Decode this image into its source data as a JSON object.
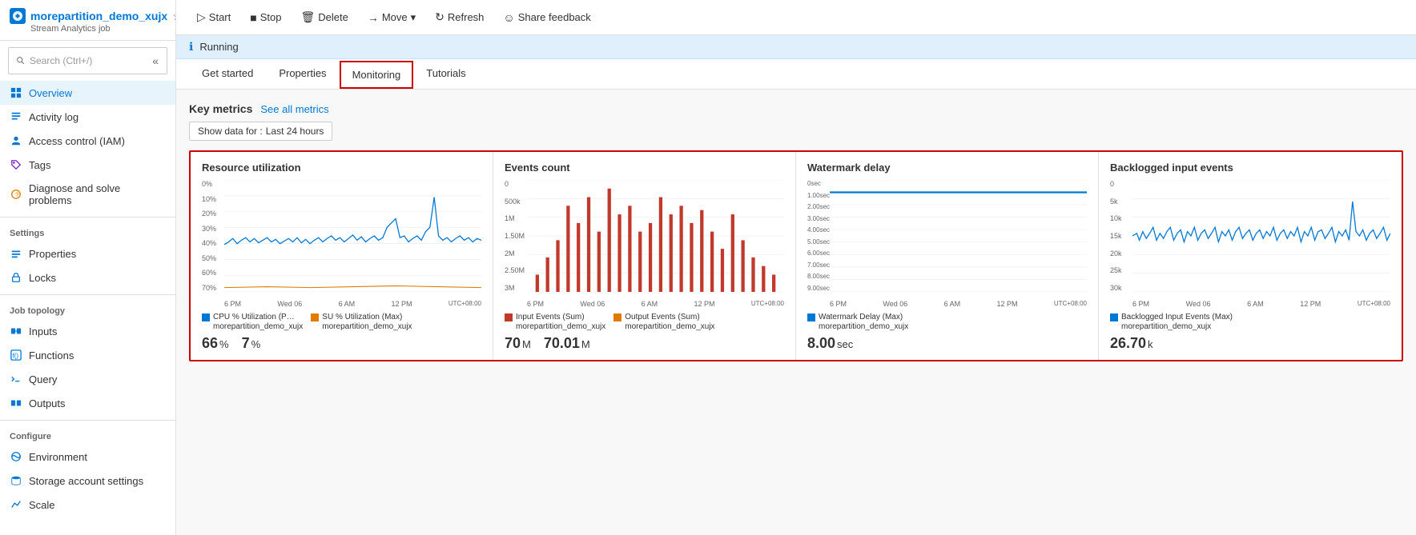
{
  "app": {
    "name": "morepartition_demo_xujx",
    "subtitle": "Stream Analytics job",
    "star_icon": "★",
    "dots_icon": "···"
  },
  "sidebar": {
    "search_placeholder": "Search (Ctrl+/)",
    "items_top": [
      {
        "id": "overview",
        "label": "Overview",
        "icon": "overview",
        "active": true
      },
      {
        "id": "activity-log",
        "label": "Activity log",
        "icon": "list"
      },
      {
        "id": "access-control",
        "label": "Access control (IAM)",
        "icon": "person"
      },
      {
        "id": "tags",
        "label": "Tags",
        "icon": "tag"
      },
      {
        "id": "diagnose",
        "label": "Diagnose and solve problems",
        "icon": "wrench"
      }
    ],
    "settings_label": "Settings",
    "settings_items": [
      {
        "id": "properties",
        "label": "Properties",
        "icon": "properties"
      },
      {
        "id": "locks",
        "label": "Locks",
        "icon": "lock"
      }
    ],
    "job_topology_label": "Job topology",
    "job_topology_items": [
      {
        "id": "inputs",
        "label": "Inputs",
        "icon": "inputs"
      },
      {
        "id": "functions",
        "label": "Functions",
        "icon": "functions"
      },
      {
        "id": "query",
        "label": "Query",
        "icon": "query"
      },
      {
        "id": "outputs",
        "label": "Outputs",
        "icon": "outputs"
      }
    ],
    "configure_label": "Configure",
    "configure_items": [
      {
        "id": "environment",
        "label": "Environment",
        "icon": "environment"
      },
      {
        "id": "storage-account",
        "label": "Storage account settings",
        "icon": "storage"
      },
      {
        "id": "scale",
        "label": "Scale",
        "icon": "scale"
      }
    ]
  },
  "toolbar": {
    "start_label": "Start",
    "stop_label": "Stop",
    "delete_label": "Delete",
    "move_label": "Move",
    "refresh_label": "Refresh",
    "share_feedback_label": "Share feedback"
  },
  "status": {
    "text": "Running"
  },
  "tabs": [
    {
      "id": "get-started",
      "label": "Get started"
    },
    {
      "id": "properties",
      "label": "Properties"
    },
    {
      "id": "monitoring",
      "label": "Monitoring",
      "active": true
    },
    {
      "id": "tutorials",
      "label": "Tutorials"
    }
  ],
  "key_metrics": {
    "title": "Key metrics",
    "see_all_label": "See all metrics",
    "filter_label": "Show data for :",
    "filter_value": "Last 24 hours"
  },
  "charts": [
    {
      "id": "resource-utilization",
      "title": "Resource utilization",
      "y_labels": [
        "70%",
        "60%",
        "50%",
        "40%",
        "30%",
        "20%",
        "10%",
        "0%"
      ],
      "x_labels": [
        "6 PM",
        "Wed 06",
        "6 AM",
        "12 PM",
        "UTC+08:00"
      ],
      "color": "#0078d4",
      "type": "line",
      "legend": [
        {
          "label": "CPU % Utilization (P…\nmorepartition_demo_xujx",
          "color": "#0078d4"
        },
        {
          "label": "SU % Utilization (Max)\nmorepartition_demo_xujx",
          "color": "#e07b00"
        }
      ],
      "values": [
        {
          "num": "66",
          "unit": "%"
        },
        {
          "num": "7",
          "unit": "%"
        }
      ]
    },
    {
      "id": "events-count",
      "title": "Events count",
      "y_labels": [
        "3M",
        "2.50M",
        "2M",
        "1.50M",
        "1M",
        "500k",
        "0"
      ],
      "x_labels": [
        "6 PM",
        "Wed 06",
        "6 AM",
        "12 PM",
        "UTC+08:00"
      ],
      "color": "#c0392b",
      "type": "bar",
      "legend": [
        {
          "label": "Input Events (Sum)\nmorepartition_demo_xujx",
          "color": "#c0392b"
        },
        {
          "label": "Output Events (Sum)\nmorepartition_demo_xujx",
          "color": "#e07b00"
        }
      ],
      "values": [
        {
          "num": "70",
          "unit": "M"
        },
        {
          "num": "70.01",
          "unit": "M"
        }
      ]
    },
    {
      "id": "watermark-delay",
      "title": "Watermark delay",
      "y_labels": [
        "9.00sec",
        "8.00sec",
        "7.00sec",
        "6.00sec",
        "5.00sec",
        "4.00sec",
        "3.00sec",
        "2.00sec",
        "1.00sec",
        "0sec"
      ],
      "x_labels": [
        "6 PM",
        "Wed 06",
        "6 AM",
        "12 PM",
        "UTC+08:00"
      ],
      "color": "#0078d4",
      "type": "line_flat",
      "legend": [
        {
          "label": "Watermark Delay (Max)\nmorepartition_demo_xujx",
          "color": "#0078d4"
        }
      ],
      "values": [
        {
          "num": "8.00",
          "unit": "sec"
        }
      ]
    },
    {
      "id": "backlogged-input",
      "title": "Backlogged input events",
      "y_labels": [
        "30k",
        "25k",
        "20k",
        "15k",
        "10k",
        "5k",
        "0"
      ],
      "x_labels": [
        "6 PM",
        "Wed 06",
        "6 AM",
        "12 PM",
        "UTC+08:00"
      ],
      "color": "#0078d4",
      "type": "line",
      "legend": [
        {
          "label": "Backlogged Input Events (Max)\nmorepartition_demo_xujx",
          "color": "#0078d4"
        }
      ],
      "values": [
        {
          "num": "26.70",
          "unit": "k"
        }
      ]
    }
  ]
}
